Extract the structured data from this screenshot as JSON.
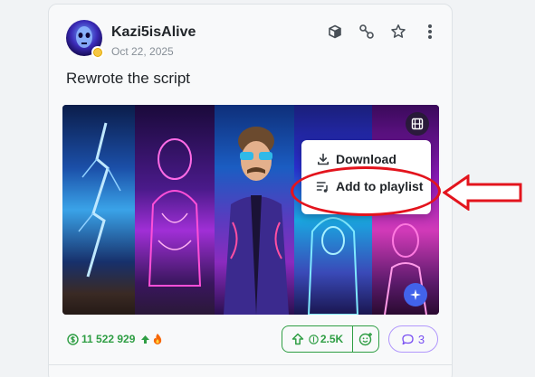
{
  "post": {
    "username": "Kazi5isAlive",
    "date": "Oct 22, 2025",
    "title": "Rewrote the script"
  },
  "header_icons": [
    "cube-icon",
    "link-icon",
    "star-icon",
    "more-vertical-icon"
  ],
  "context_menu": {
    "download_label": "Download",
    "add_to_playlist_label": "Add to playlist"
  },
  "footer": {
    "buzz_amount": "11 522 929",
    "tip_amount": "2.5K",
    "comment_count": "3"
  },
  "colors": {
    "accent_green": "#2f9e44",
    "comment_purple": "#7950f2",
    "annotation_red": "#e3141d",
    "media_button_blue": "#4263eb"
  }
}
